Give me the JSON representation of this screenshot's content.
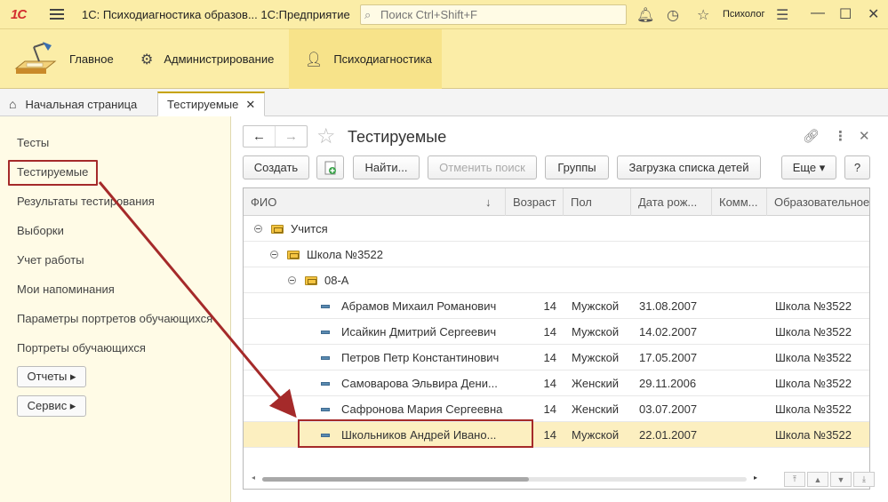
{
  "titlebar": {
    "logo": "1С",
    "title": "1С: Психодиагностика образов...   1С:Предприятие",
    "search_placeholder": "Поиск Ctrl+Shift+F",
    "user": "Психолог"
  },
  "sections": [
    {
      "label": "Главное"
    },
    {
      "label": "Администрирование"
    },
    {
      "label": "Психодиагностика"
    }
  ],
  "tabs": {
    "home": "Начальная страница",
    "active": "Тестируемые"
  },
  "leftnav": {
    "items": [
      "Тесты",
      "Тестируемые",
      "Результаты тестирования",
      "Выборки",
      "Учет работы",
      "Мои напоминания",
      "Параметры портретов обучающихся",
      "Портреты обучающихся"
    ],
    "buttons": [
      "Отчеты ▸",
      "Сервис ▸"
    ]
  },
  "form": {
    "title": "Тестируемые",
    "buttons": {
      "create": "Создать",
      "find": "Найти...",
      "cancel_search": "Отменить поиск",
      "groups": "Группы",
      "load_children": "Загрузка списка детей",
      "more": "Еще ▾",
      "help": "?"
    }
  },
  "table": {
    "columns": [
      "ФИО",
      "Возраст",
      "Пол",
      "Дата рож...",
      "Комм...",
      "Образовательное"
    ],
    "sort_indicator": "↓",
    "groups": [
      "Учится",
      "Школа №3522",
      "08-А"
    ],
    "rows": [
      {
        "fio": "Абрамов Михаил Романович",
        "age": "14",
        "sex": "Мужской",
        "dob": "31.08.2007",
        "comment": "",
        "school": "Школа №3522"
      },
      {
        "fio": "Исайкин Дмитрий Сергеевич",
        "age": "14",
        "sex": "Мужской",
        "dob": "14.02.2007",
        "comment": "",
        "school": "Школа №3522"
      },
      {
        "fio": "Петров Петр Константинович",
        "age": "14",
        "sex": "Мужской",
        "dob": "17.05.2007",
        "comment": "",
        "school": "Школа №3522"
      },
      {
        "fio": "Самоварова Эльвира Дени...",
        "age": "14",
        "sex": "Женский",
        "dob": "29.11.2006",
        "comment": "",
        "school": "Школа №3522"
      },
      {
        "fio": "Сафронова Мария Сергеевна",
        "age": "14",
        "sex": "Женский",
        "dob": "03.07.2007",
        "comment": "",
        "school": "Школа №3522"
      },
      {
        "fio": "Школьников Андрей Ивано...",
        "age": "14",
        "sex": "Мужской",
        "dob": "22.01.2007",
        "comment": "",
        "school": "Школа №3522"
      }
    ]
  },
  "colors": {
    "accent": "#fbeda7",
    "highlight": "#a52a2a",
    "selected_row": "#fcefc0"
  }
}
